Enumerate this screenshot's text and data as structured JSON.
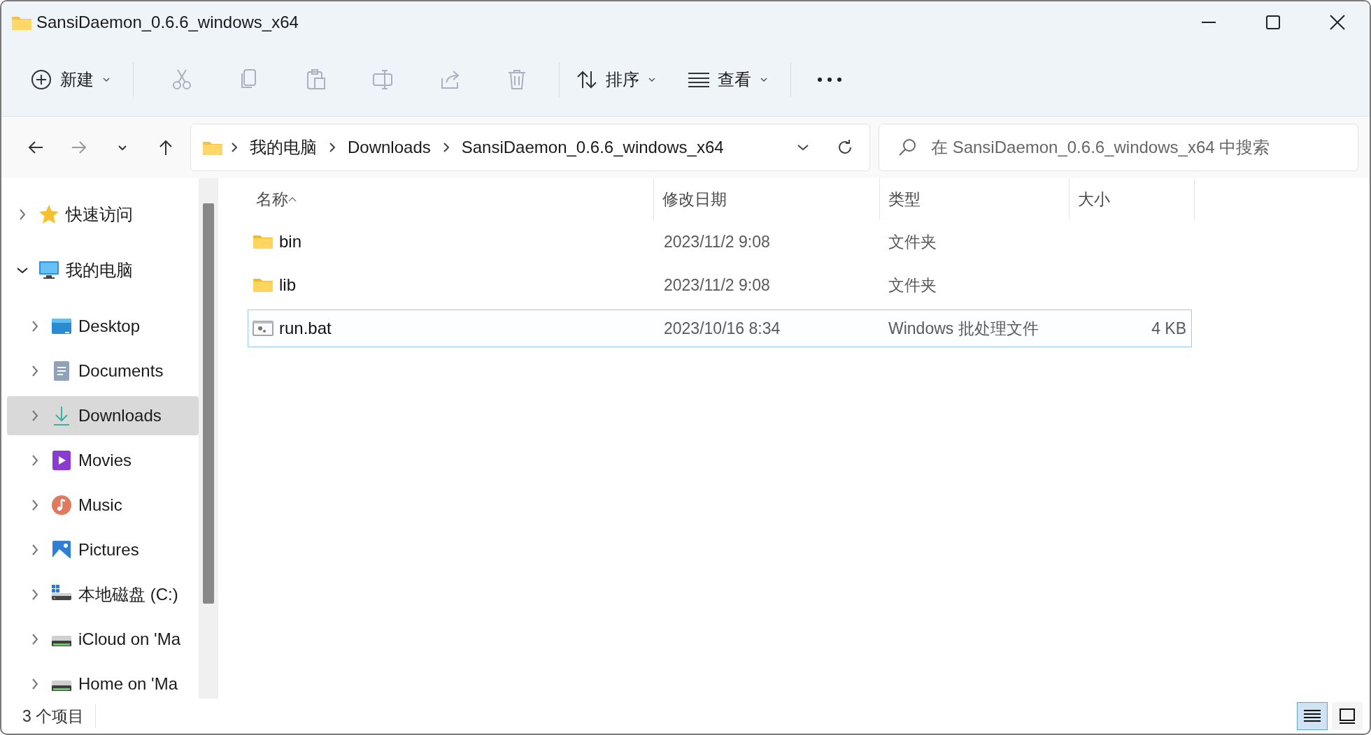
{
  "window": {
    "title": "SansiDaemon_0.6.6_windows_x64"
  },
  "toolbar": {
    "new_label": "新建",
    "actions": [
      {
        "kind": "cut",
        "disabled": true
      },
      {
        "kind": "copy",
        "disabled": true
      },
      {
        "kind": "paste",
        "disabled": true
      },
      {
        "kind": "rename",
        "disabled": true
      },
      {
        "kind": "share",
        "disabled": true
      },
      {
        "kind": "delete",
        "disabled": true
      }
    ],
    "sort_label": "排序",
    "view_label": "查看"
  },
  "navigation": [
    {
      "kind": "back",
      "disabled": false
    },
    {
      "kind": "forward",
      "disabled": true
    },
    {
      "kind": "recent",
      "disabled": false
    },
    {
      "kind": "up",
      "disabled": false
    }
  ],
  "breadcrumb": [
    "我的电脑",
    "Downloads",
    "SansiDaemon_0.6.6_windows_x64"
  ],
  "search": {
    "placeholder": "在 SansiDaemon_0.6.6_windows_x64 中搜索"
  },
  "sidebar": {
    "items": [
      {
        "label": "快速访问",
        "kind": "star",
        "expanded": false,
        "selected": false
      },
      {
        "label": "我的电脑",
        "kind": "computer",
        "expanded": true,
        "selected": false,
        "children": [
          {
            "label": "Desktop",
            "kind": "desktop",
            "expanded": false,
            "selected": false
          },
          {
            "label": "Documents",
            "kind": "documents",
            "expanded": false,
            "selected": false
          },
          {
            "label": "Downloads",
            "kind": "downloads",
            "expanded": false,
            "selected": true
          },
          {
            "label": "Movies",
            "kind": "movies",
            "expanded": false,
            "selected": false
          },
          {
            "label": "Music",
            "kind": "music",
            "expanded": false,
            "selected": false
          },
          {
            "label": "Pictures",
            "kind": "pictures",
            "expanded": false,
            "selected": false
          },
          {
            "label": "本地磁盘 (C:)",
            "kind": "disk",
            "expanded": false,
            "selected": false
          },
          {
            "label": "iCloud on 'Ma",
            "kind": "network-drive",
            "expanded": false,
            "selected": false
          },
          {
            "label": "Home on 'Ma",
            "kind": "network-drive",
            "expanded": false,
            "selected": false
          }
        ]
      }
    ]
  },
  "table": {
    "columns": [
      "名称",
      "修改日期",
      "类型",
      "大小"
    ],
    "rows": [
      {
        "name": "bin",
        "date": "2023/11/2 9:08",
        "type": "文件夹",
        "size": "",
        "kind": "folder",
        "hovered": false
      },
      {
        "name": "lib",
        "date": "2023/11/2 9:08",
        "type": "文件夹",
        "size": "",
        "kind": "folder",
        "hovered": false
      },
      {
        "name": "run.bat",
        "date": "2023/10/16 8:34",
        "type": "Windows 批处理文件",
        "size": "4 KB",
        "kind": "batch",
        "hovered": true
      }
    ]
  },
  "status_bar": {
    "item_count": "3 个项目",
    "views": [
      {
        "kind": "details",
        "selected": true
      },
      {
        "kind": "tiles",
        "selected": false
      }
    ]
  }
}
